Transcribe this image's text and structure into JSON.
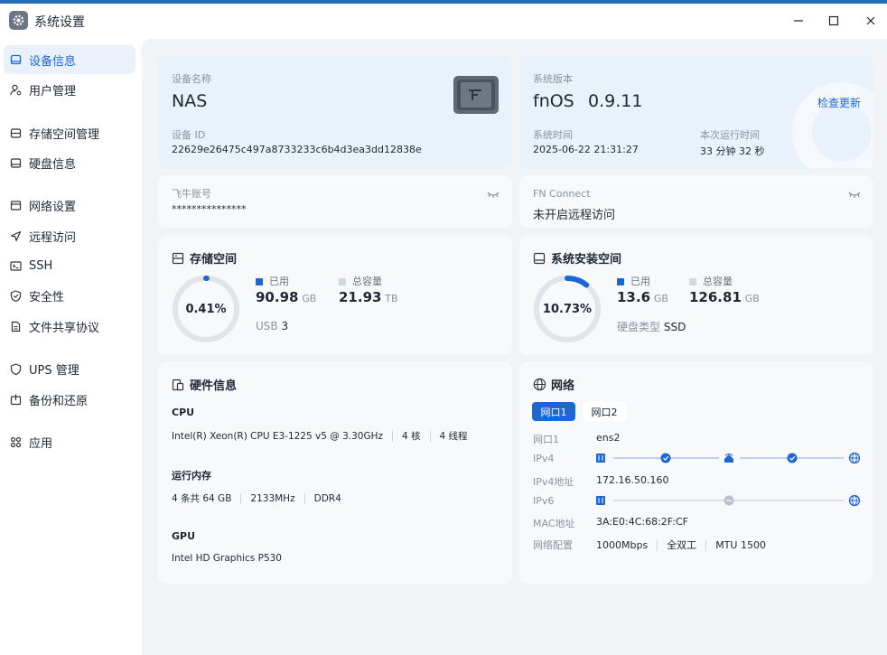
{
  "window": {
    "title": "系统设置"
  },
  "sidebar": {
    "items": [
      {
        "label": "设备信息",
        "icon": "monitor-icon",
        "active": true
      },
      {
        "label": "用户管理",
        "icon": "user-icon"
      },
      {
        "label": "存储空间管理",
        "icon": "storage-icon"
      },
      {
        "label": "硬盘信息",
        "icon": "disk-icon"
      },
      {
        "label": "网络设置",
        "icon": "network-icon"
      },
      {
        "label": "远程访问",
        "icon": "send-icon"
      },
      {
        "label": "SSH",
        "icon": "terminal-icon"
      },
      {
        "label": "安全性",
        "icon": "shield-check-icon"
      },
      {
        "label": "文件共享协议",
        "icon": "file-icon"
      },
      {
        "label": "UPS 管理",
        "icon": "ups-shield-icon"
      },
      {
        "label": "备份和还原",
        "icon": "backup-icon"
      },
      {
        "label": "应用",
        "icon": "apps-icon"
      }
    ]
  },
  "device": {
    "name_label": "设备名称",
    "name": "NAS",
    "id_label": "设备 ID",
    "id": "22629e26475c497a8733233c6b4d3ea3dd12838e"
  },
  "system": {
    "version_label": "系统版本",
    "os": "fnOS",
    "version": "0.9.11",
    "check_update": "检查更新",
    "time_label": "系统时间",
    "time": "2025-06-22 21:31:27",
    "uptime_label": "本次运行时间",
    "uptime": "33 分钟 32 秒"
  },
  "account": {
    "label": "飞牛账号",
    "value": "***************"
  },
  "fnconnect": {
    "label": "FN Connect",
    "value": "未开启远程访问"
  },
  "storage": {
    "title": "存储空间",
    "percent_text": "0.41%",
    "percent": 0.41,
    "used_label": "已用",
    "used_value": "90.98",
    "used_unit": "GB",
    "total_label": "总容量",
    "total_value": "21.93",
    "total_unit": "TB",
    "usb_label": "USB",
    "usb_count": "3"
  },
  "sysdisk": {
    "title": "系统安装空间",
    "percent_text": "10.73%",
    "percent": 10.73,
    "used_label": "已用",
    "used_value": "13.6",
    "used_unit": "GB",
    "total_label": "总容量",
    "total_value": "126.81",
    "total_unit": "GB",
    "type_label": "硬盘类型",
    "type_value": "SSD"
  },
  "hardware": {
    "title": "硬件信息",
    "cpu_label": "CPU",
    "cpu_model": "Intel(R) Xeon(R) CPU E3-1225 v5 @ 3.30GHz",
    "cpu_cores": "4 核",
    "cpu_threads": "4 线程",
    "mem_label": "运行内存",
    "mem_size": "4 条共 64 GB",
    "mem_freq": "2133MHz",
    "mem_type": "DDR4",
    "gpu_label": "GPU",
    "gpu_model": "Intel HD Graphics P530"
  },
  "network": {
    "title": "网络",
    "tabs": [
      "网口1",
      "网口2"
    ],
    "port_label": "网口1",
    "port_value": "ens2",
    "ipv4_label": "IPv4",
    "ipv4_addr_label": "IPv4地址",
    "ipv4_addr": "172.16.50.160",
    "ipv6_label": "IPv6",
    "mac_label": "MAC地址",
    "mac": "3A:E0:4C:68:2F:CF",
    "config_label": "网络配置",
    "speed": "1000Mbps",
    "duplex": "全双工",
    "mtu": "MTU 1500"
  },
  "colors": {
    "accent": "#1b67d6",
    "ring_track": "#e1e4e9",
    "legend_total": "#d4d8de",
    "card_blue": "#e9f1fb"
  }
}
